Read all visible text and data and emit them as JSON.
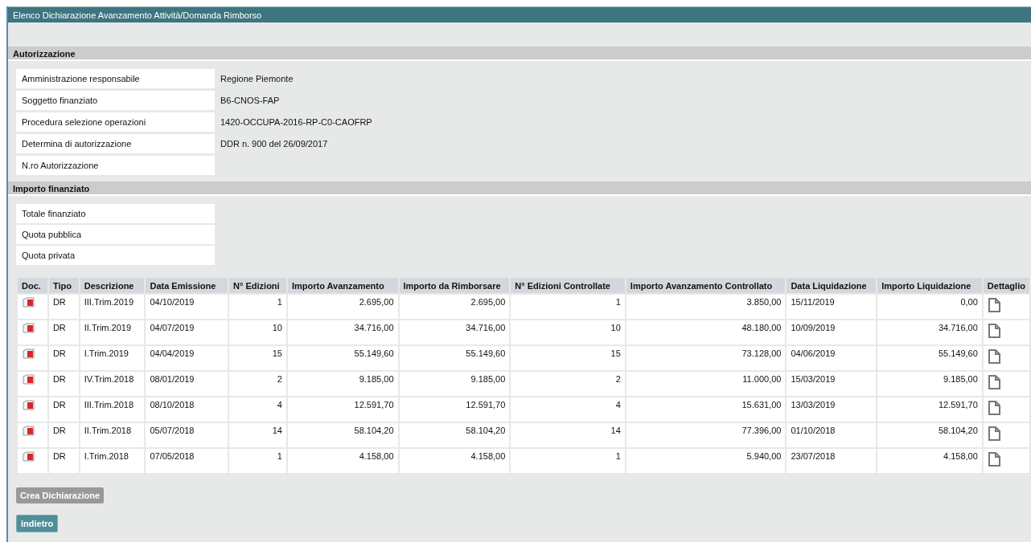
{
  "window": {
    "title": "Elenco Dichiarazione Avanzamento Attività/Domanda Rimborso"
  },
  "autorizzazione": {
    "title": "Autorizzazione",
    "fields": [
      {
        "label": "Amministrazione responsabile",
        "value": "Regione Piemonte"
      },
      {
        "label": "Soggetto finanziato",
        "value": "B6-CNOS-FAP"
      },
      {
        "label": "Procedura selezione operazioni",
        "value": "1420-OCCUPA-2016-RP-C0-CAOFRP"
      },
      {
        "label": "Determina di autorizzazione",
        "value": "DDR n. 900 del 26/09/2017"
      },
      {
        "label": "N.ro Autorizzazione"
      }
    ]
  },
  "importo": {
    "title": "Importo finanziato",
    "fields": [
      {
        "label": "Totale finanziato"
      },
      {
        "label": "Quota pubblica"
      },
      {
        "label": "Quota privata"
      }
    ]
  },
  "table": {
    "columns": [
      "Doc.",
      "Tipo",
      "Descrizione",
      "Data Emissione",
      "N° Edizioni",
      "Importo Avanzamento",
      "Importo da Rimborsare",
      "N° Edizioni Controllate",
      "Importo Avanzamento Controllato",
      "Data Liquidazione",
      "Importo Liquidazione",
      "Dettaglio"
    ],
    "rows": [
      {
        "tipo": "DR",
        "descrizione": "III.Trim.2019",
        "data_emissione": "04/10/2019",
        "edizioni": "1",
        "importo_avanzamento": "2.695,00",
        "importo_rimborsare": "2.695,00",
        "edizioni_controllate": "1",
        "importo_controllato": "3.850,00",
        "data_liquidazione": "15/11/2019",
        "importo_liquidazione": "0,00"
      },
      {
        "tipo": "DR",
        "descrizione": "II.Trim.2019",
        "data_emissione": "04/07/2019",
        "edizioni": "10",
        "importo_avanzamento": "34.716,00",
        "importo_rimborsare": "34.716,00",
        "edizioni_controllate": "10",
        "importo_controllato": "48.180,00",
        "data_liquidazione": "10/09/2019",
        "importo_liquidazione": "34.716,00"
      },
      {
        "tipo": "DR",
        "descrizione": "I.Trim.2019",
        "data_emissione": "04/04/2019",
        "edizioni": "15",
        "importo_avanzamento": "55.149,60",
        "importo_rimborsare": "55.149,60",
        "edizioni_controllate": "15",
        "importo_controllato": "73.128,00",
        "data_liquidazione": "04/06/2019",
        "importo_liquidazione": "55.149,60"
      },
      {
        "tipo": "DR",
        "descrizione": "IV.Trim.2018",
        "data_emissione": "08/01/2019",
        "edizioni": "2",
        "importo_avanzamento": "9.185,00",
        "importo_rimborsare": "9.185,00",
        "edizioni_controllate": "2",
        "importo_controllato": "11.000,00",
        "data_liquidazione": "15/03/2019",
        "importo_liquidazione": "9.185,00"
      },
      {
        "tipo": "DR",
        "descrizione": "III.Trim.2018",
        "data_emissione": "08/10/2018",
        "edizioni": "4",
        "importo_avanzamento": "12.591,70",
        "importo_rimborsare": "12.591,70",
        "edizioni_controllate": "4",
        "importo_controllato": "15.631,00",
        "data_liquidazione": "13/03/2019",
        "importo_liquidazione": "12.591,70"
      },
      {
        "tipo": "DR",
        "descrizione": "II.Trim.2018",
        "data_emissione": "05/07/2018",
        "edizioni": "14",
        "importo_avanzamento": "58.104,20",
        "importo_rimborsare": "58.104,20",
        "edizioni_controllate": "14",
        "importo_controllato": "77.396,00",
        "data_liquidazione": "01/10/2018",
        "importo_liquidazione": "58.104,20"
      },
      {
        "tipo": "DR",
        "descrizione": "I.Trim.2018",
        "data_emissione": "07/05/2018",
        "edizioni": "1",
        "importo_avanzamento": "4.158,00",
        "importo_rimborsare": "4.158,00",
        "edizioni_controllate": "1",
        "importo_controllato": "5.940,00",
        "data_liquidazione": "23/07/2018",
        "importo_liquidazione": "4.158,00"
      }
    ]
  },
  "buttons": [
    {
      "label": "Crea Dichiarazione",
      "kind": "secondary"
    },
    {
      "label": "indietro",
      "kind": "primary"
    }
  ]
}
